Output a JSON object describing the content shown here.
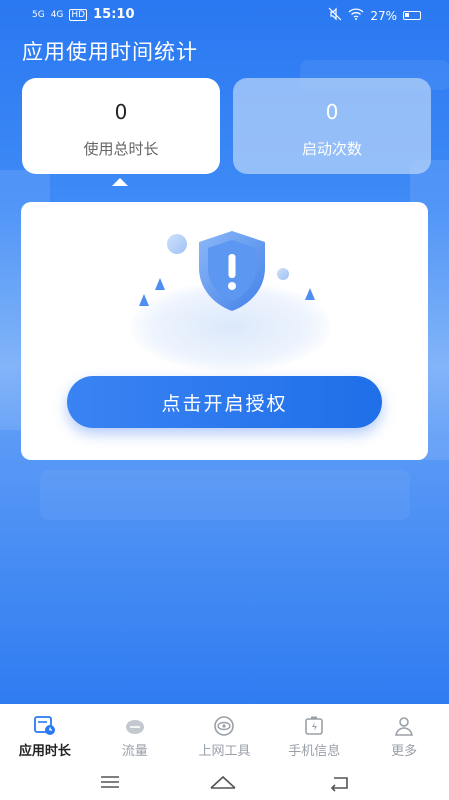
{
  "status_bar": {
    "signal_1": "5G",
    "signal_2": "4G",
    "hd_badge": "HD",
    "time": "15:10",
    "battery": "27%",
    "icons": [
      "mute-icon",
      "wifi-icon",
      "battery-icon"
    ]
  },
  "header": {
    "title": "应用使用时间统计"
  },
  "stats": [
    {
      "value": "0",
      "label": "使用总时长"
    },
    {
      "value": "0",
      "label": "启动次数"
    }
  ],
  "permission": {
    "button_label": "点击开启授权",
    "illustration_icon": "shield-warning-icon"
  },
  "tabs": [
    {
      "label": "应用时长",
      "icon": "app-time-icon",
      "active": true
    },
    {
      "label": "流量",
      "icon": "traffic-icon",
      "active": false
    },
    {
      "label": "上网工具",
      "icon": "eye-icon",
      "active": false
    },
    {
      "label": "手机信息",
      "icon": "phone-battery-icon",
      "active": false
    },
    {
      "label": "更多",
      "icon": "user-icon",
      "active": false
    }
  ],
  "system_nav": [
    "menu-icon",
    "home-icon",
    "back-icon"
  ],
  "colors": {
    "primary": "#2a78f2",
    "button": "#1f6fe9",
    "tab_inactive": "#9aa0a8"
  }
}
